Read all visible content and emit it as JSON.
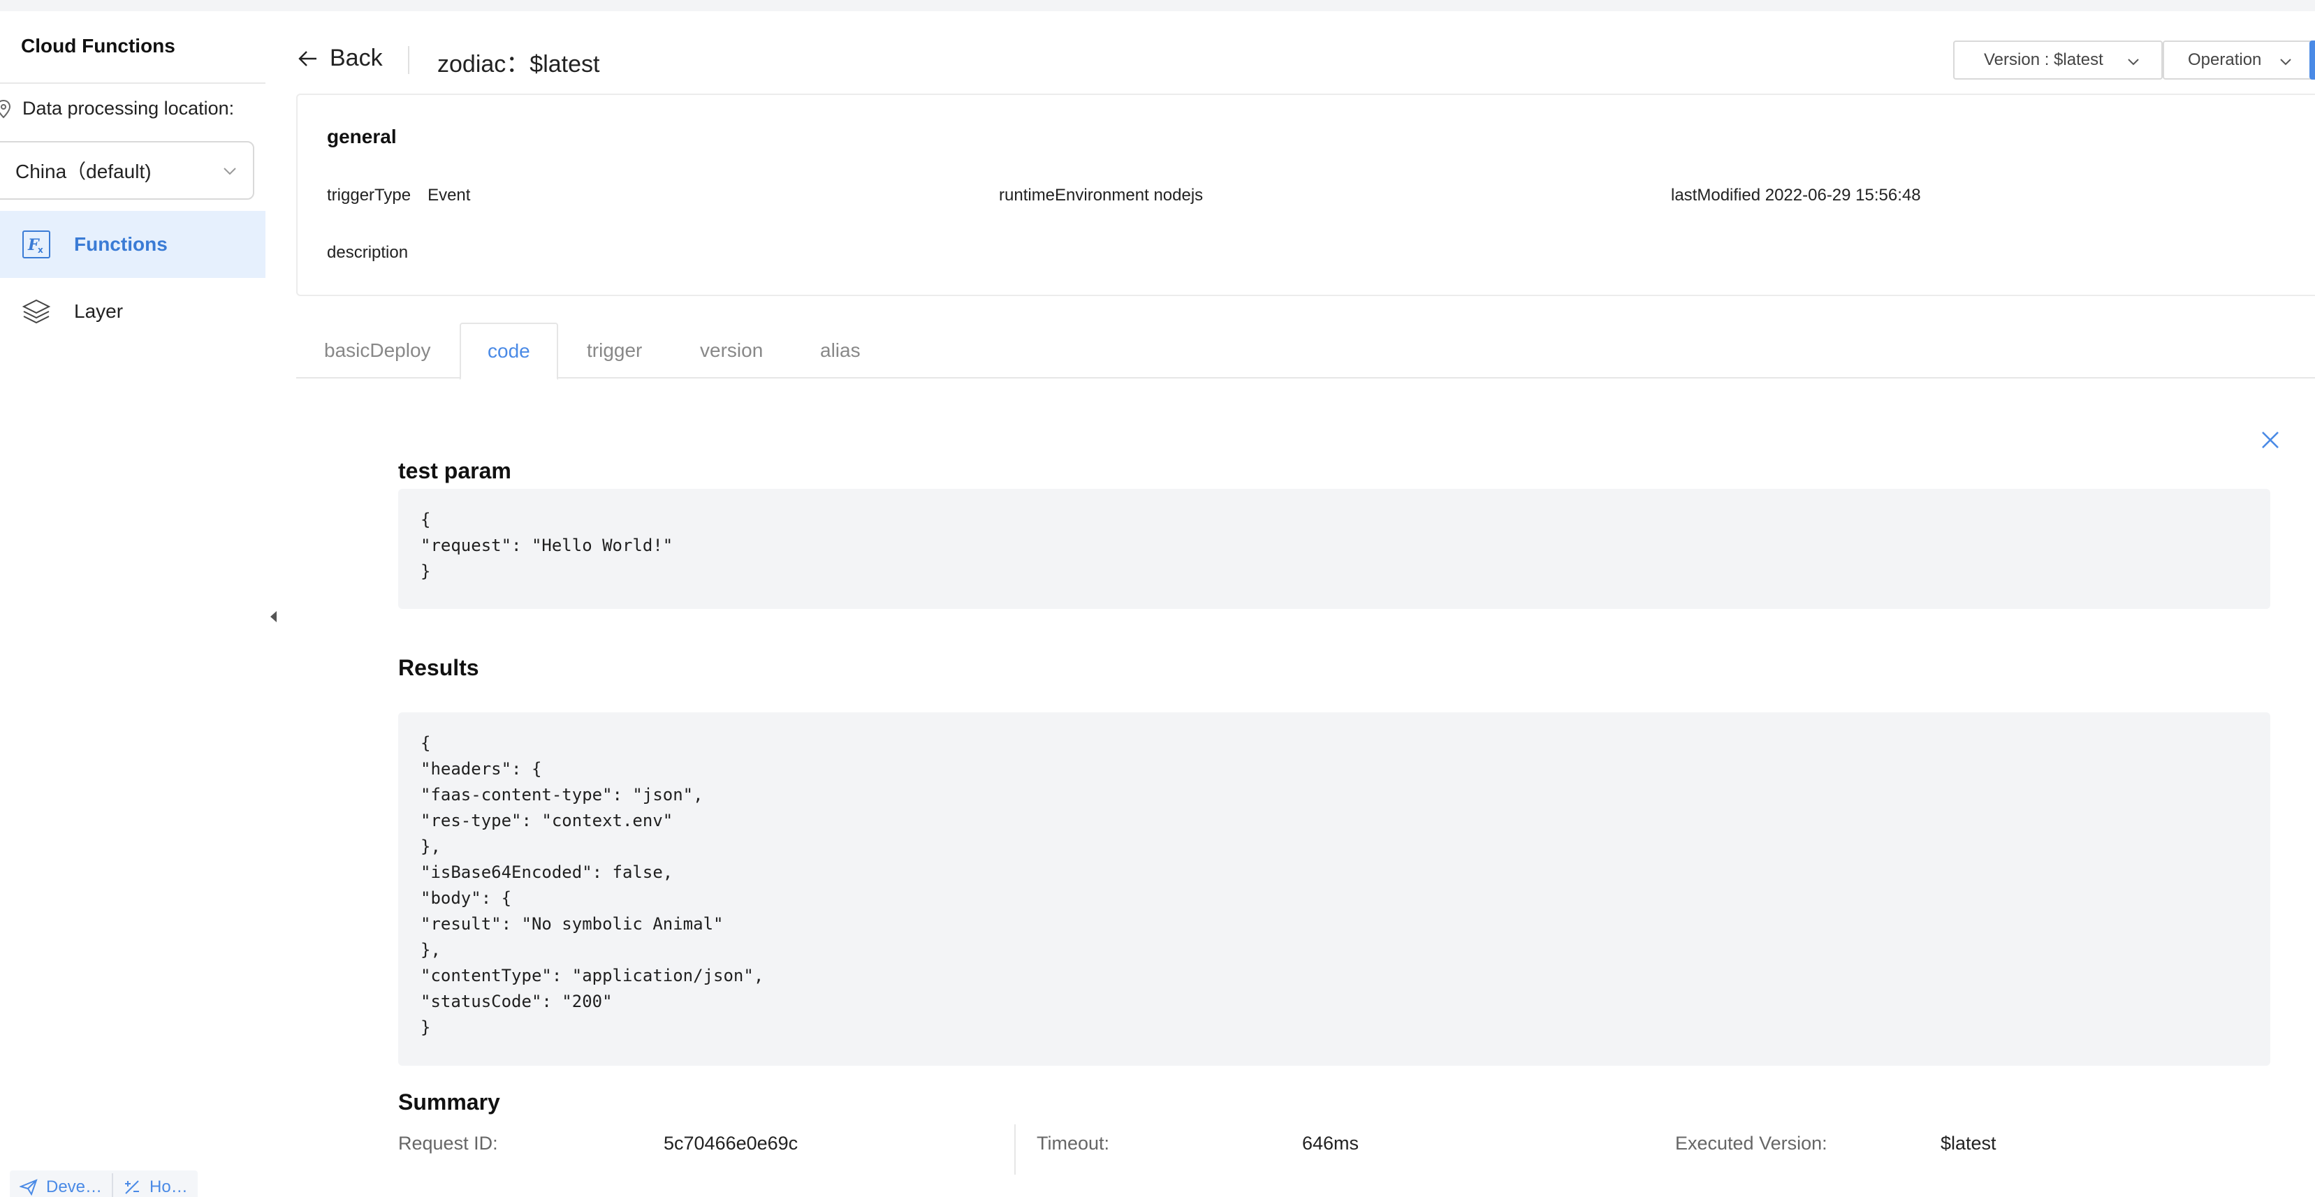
{
  "sidebar": {
    "title": "Cloud Functions",
    "location_label": "Data processing location:",
    "location_value": "China（default)",
    "nav": [
      {
        "label": "Functions",
        "icon": "function-icon",
        "active": true
      },
      {
        "label": "Layer",
        "icon": "layers-icon",
        "active": false
      }
    ],
    "bottom": {
      "dev_label": "Deve…",
      "ho_label": "Ho…"
    }
  },
  "header": {
    "back_label": "Back",
    "title": "zodiac：$latest",
    "version_button": "Version : $latest",
    "operation_button": "Operation"
  },
  "general": {
    "title": "general",
    "trigger_type_key": "triggerType",
    "trigger_type_value": "Event",
    "runtime_key": "runtimeEnvironment",
    "runtime_value": "nodejs",
    "last_modified_key": "lastModified",
    "last_modified_value": "2022-06-29 15:56:48",
    "description_key": "description",
    "description_value": ""
  },
  "tabs": [
    {
      "label": "basicDeploy",
      "active": false
    },
    {
      "label": "code",
      "active": true
    },
    {
      "label": "trigger",
      "active": false
    },
    {
      "label": "version",
      "active": false
    },
    {
      "label": "alias",
      "active": false
    }
  ],
  "test": {
    "param_title": "test param",
    "param_code": "{\n\"request\": \"Hello World!\"\n}",
    "results_title": "Results",
    "results_code": "{\n\"headers\": {\n\"faas-content-type\": \"json\",\n\"res-type\": \"context.env\"\n},\n\"isBase64Encoded\": false,\n\"body\": {\n\"result\": \"No symbolic Animal\"\n},\n\"contentType\": \"application/json\",\n\"statusCode\": \"200\"\n}",
    "summary_title": "Summary",
    "summary": {
      "request_id_label": "Request ID:",
      "request_id_value": "5c70466e0e69c",
      "timeout_label": "Timeout:",
      "timeout_value": "646ms",
      "executed_version_label": "Executed Version:",
      "executed_version_value": "$latest"
    }
  },
  "colors": {
    "accent": "#4a8ae6",
    "active_nav_bg": "#e6f0fd",
    "code_bg": "#f3f4f6"
  }
}
